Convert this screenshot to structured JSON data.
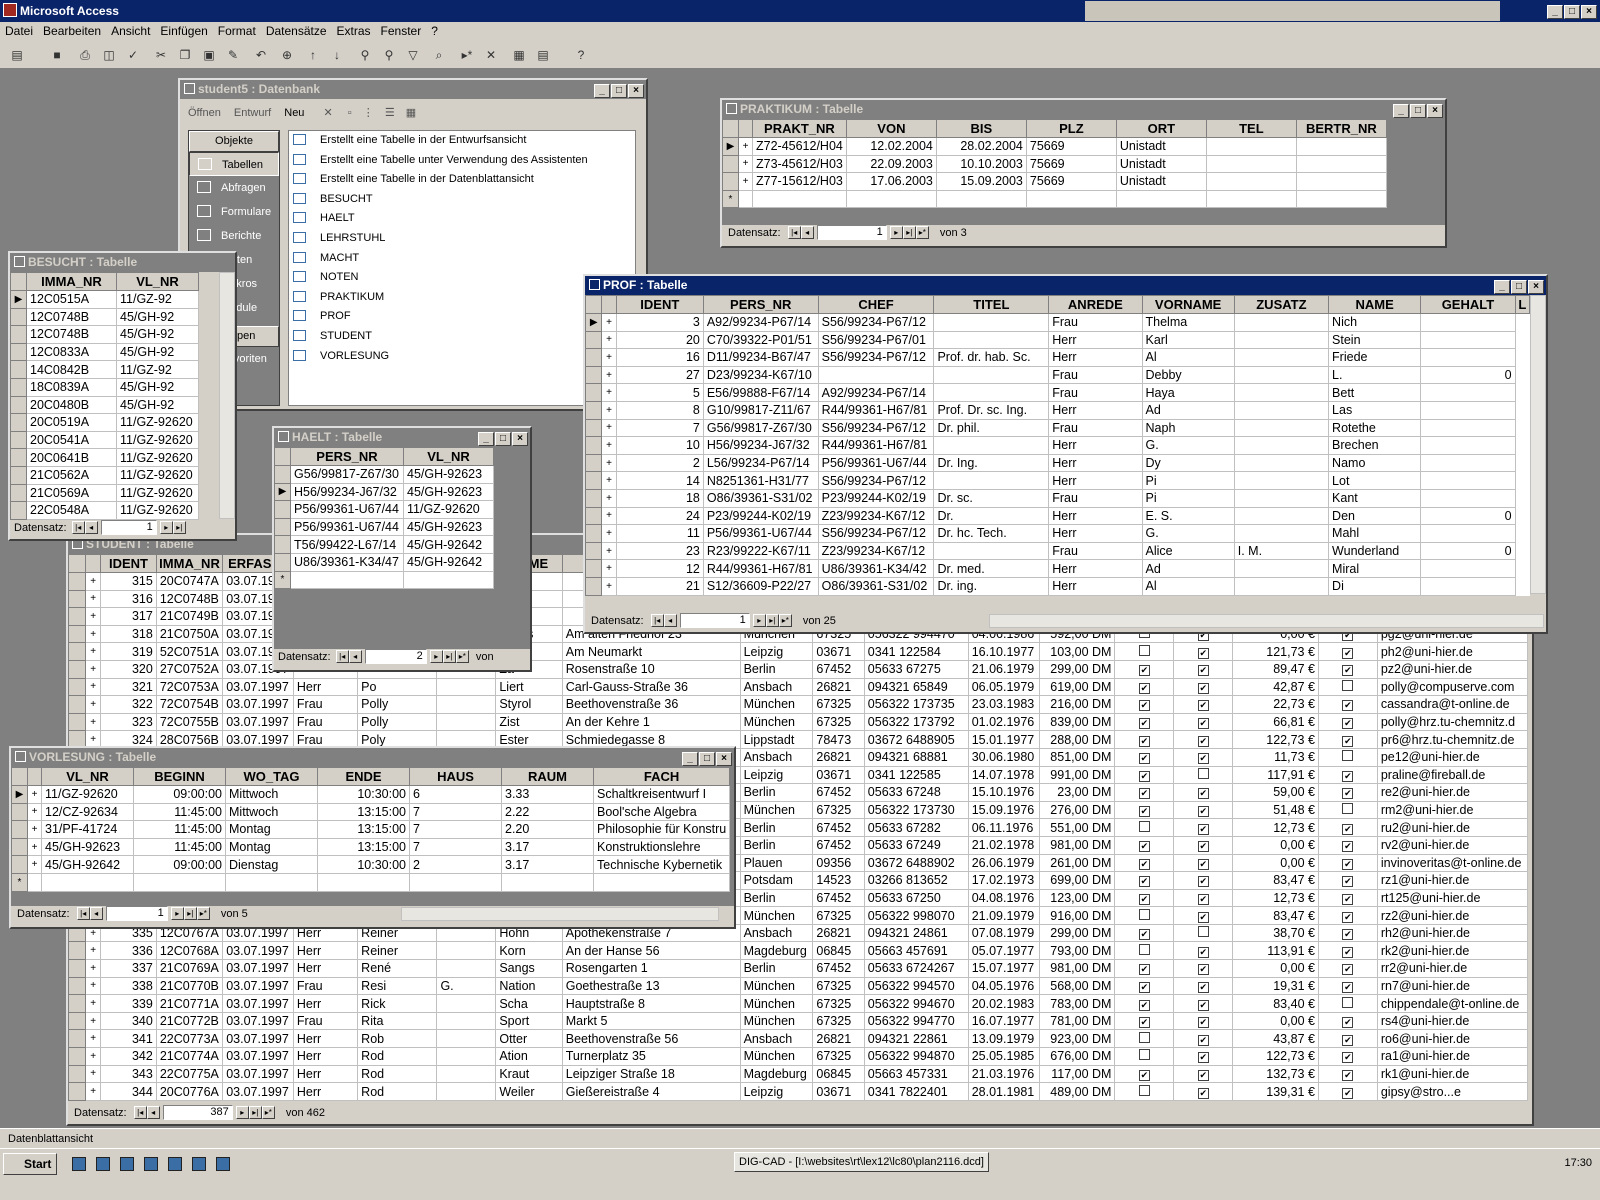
{
  "app": {
    "title": "Microsoft Access"
  },
  "menu": [
    "Datei",
    "Bearbeiten",
    "Ansicht",
    "Einfügen",
    "Format",
    "Datensätze",
    "Extras",
    "Fenster",
    "?"
  ],
  "status": "Datenblattansicht",
  "taskbar": {
    "start": "Start",
    "task": "DIG-CAD - [I:\\websites\\rt\\lex12\\lc80\\plan2116.dcd]",
    "clock": "17:30"
  },
  "db": {
    "title": "student5 : Datenbank",
    "tools": {
      "open": "Öffnen",
      "design": "Entwurf",
      "new": "Neu"
    },
    "objects_label": "Objekte",
    "groups_label": "Gruppen",
    "nav": [
      "Tabellen",
      "Abfragen",
      "Formulare",
      "Berichte",
      "Seiten",
      "Makros",
      "Module"
    ],
    "favorites": "Favoriten",
    "items": [
      "Erstellt eine Tabelle in der Entwurfsansicht",
      "Erstellt eine Tabelle unter Verwendung des Assistenten",
      "Erstellt eine Tabelle in der Datenblattansicht",
      "BESUCHT",
      "HAELT",
      "LEHRSTUHL",
      "MACHT",
      "NOTEN",
      "PRAKTIKUM",
      "PROF",
      "STUDENT",
      "VORLESUNG"
    ]
  },
  "nav_label": "Datensatz:",
  "praktikum": {
    "title": "PRAKTIKUM : Tabelle",
    "cols": [
      "PRAKT_NR",
      "VON",
      "BIS",
      "PLZ",
      "ORT",
      "TEL",
      "BERTR_NR"
    ],
    "rows": [
      [
        "Z72-45612/H04",
        "12.02.2004",
        "28.02.2004",
        "75669",
        "Unistadt",
        "",
        ""
      ],
      [
        "Z73-45612/H03",
        "22.09.2003",
        "10.10.2003",
        "75669",
        "Unistadt",
        "",
        ""
      ],
      [
        "Z77-15612/H03",
        "17.06.2003",
        "15.09.2003",
        "75669",
        "Unistadt",
        "",
        ""
      ]
    ],
    "rec": "1",
    "of": "von 3"
  },
  "besucht": {
    "title": "BESUCHT : Tabelle",
    "cols": [
      "IMMA_NR",
      "VL_NR"
    ],
    "rows": [
      [
        "12C0515A",
        "11/GZ-92"
      ],
      [
        "12C0748B",
        "45/GH-92"
      ],
      [
        "12C0748B",
        "45/GH-92"
      ],
      [
        "12C0833A",
        "45/GH-92"
      ],
      [
        "14C0842B",
        "11/GZ-92"
      ],
      [
        "18C0839A",
        "45/GH-92"
      ],
      [
        "20C0480B",
        "45/GH-92"
      ],
      [
        "20C0519A",
        "11/GZ-92620"
      ],
      [
        "20C0541A",
        "11/GZ-92620"
      ],
      [
        "20C0641B",
        "11/GZ-92620"
      ],
      [
        "21C0562A",
        "11/GZ-92620"
      ],
      [
        "21C0569A",
        "11/GZ-92620"
      ],
      [
        "22C0548A",
        "11/GZ-92620"
      ]
    ],
    "rec": "1"
  },
  "haelt": {
    "title": "HAELT : Tabelle",
    "cols": [
      "PERS_NR",
      "VL_NR"
    ],
    "rows": [
      [
        "G56/99817-Z67/30",
        "45/GH-92623"
      ],
      [
        "H56/99234-J67/32",
        "45/GH-92623"
      ],
      [
        "P56/99361-U67/44",
        "11/GZ-92620"
      ],
      [
        "P56/99361-U67/44",
        "45/GH-92623"
      ],
      [
        "T56/99422-L67/14",
        "45/GH-92642"
      ],
      [
        "U86/39361-K34/47",
        "45/GH-92642"
      ]
    ],
    "rec": "2",
    "of": "von"
  },
  "prof": {
    "title": "PROF : Tabelle",
    "cols": [
      "IDENT",
      "PERS_NR",
      "CHEF",
      "TITEL",
      "ANREDE",
      "VORNAME",
      "ZUSATZ",
      "NAME",
      "GEHALT",
      "L"
    ],
    "rows": [
      [
        "3",
        "A92/99234-P67/14",
        "S56/99234-P67/12",
        "",
        "Frau",
        "Thelma",
        "",
        "Nich",
        ""
      ],
      [
        "20",
        "C70/39322-P01/51",
        "S56/99234-P67/01",
        "",
        "Herr",
        "Karl",
        "",
        "Stein",
        ""
      ],
      [
        "16",
        "D11/99234-B67/47",
        "S56/99234-P67/12",
        "Prof. dr. hab. Sc.",
        "Herr",
        "Al",
        "",
        "Friede",
        ""
      ],
      [
        "27",
        "D23/99234-K67/10",
        "",
        "",
        "Frau",
        "Debby",
        "",
        "L.",
        "0"
      ],
      [
        "5",
        "E56/99888-F67/14",
        "A92/99234-P67/14",
        "",
        "Frau",
        "Haya",
        "",
        "Bett",
        ""
      ],
      [
        "8",
        "G10/99817-Z11/67",
        "R44/99361-H67/81",
        "Prof. Dr. sc. Ing.",
        "Herr",
        "Ad",
        "",
        "Las",
        ""
      ],
      [
        "7",
        "G56/99817-Z67/30",
        "S56/99234-P67/12",
        "Dr. phil.",
        "Frau",
        "Naph",
        "",
        "Rotethe",
        ""
      ],
      [
        "10",
        "H56/99234-J67/32",
        "R44/99361-H67/81",
        "",
        "Herr",
        "G.",
        "",
        "Brechen",
        ""
      ],
      [
        "2",
        "L56/99234-P67/14",
        "P56/99361-U67/44",
        "Dr. Ing.",
        "Herr",
        "Dy",
        "",
        "Namo",
        ""
      ],
      [
        "14",
        "N8251361-H31/77",
        "S56/99234-P67/12",
        "",
        "Herr",
        "Pi",
        "",
        "Lot",
        ""
      ],
      [
        "18",
        "O86/39361-S31/02",
        "P23/99244-K02/19",
        "Dr. sc.",
        "Frau",
        "Pi",
        "",
        "Kant",
        ""
      ],
      [
        "24",
        "P23/99244-K02/19",
        "Z23/99234-K67/12",
        "Dr.",
        "Herr",
        "E. S.",
        "",
        "Den",
        "0"
      ],
      [
        "11",
        "P56/99361-U67/44",
        "S56/99234-P67/12",
        "Dr. hc. Tech.",
        "Herr",
        "G.",
        "",
        "Mahl",
        ""
      ],
      [
        "23",
        "R23/99222-K67/11",
        "Z23/99234-K67/12",
        "",
        "Frau",
        "Alice",
        "I. M.",
        "Wunderland",
        "0"
      ],
      [
        "12",
        "R44/99361-H67/81",
        "U86/39361-K34/42",
        "Dr. med.",
        "Herr",
        "Ad",
        "",
        "Miral",
        ""
      ],
      [
        "21",
        "S12/36609-P22/27",
        "O86/39361-S31/02",
        "Dr. ing.",
        "Herr",
        "Al",
        "",
        "Di",
        ""
      ]
    ],
    "rec": "1",
    "of": "von 25"
  },
  "vorlesung": {
    "title": "VORLESUNG : Tabelle",
    "cols": [
      "VL_NR",
      "BEGINN",
      "WO_TAG",
      "ENDE",
      "HAUS",
      "RAUM",
      "FACH"
    ],
    "rows": [
      [
        "11/GZ-92620",
        "09:00:00",
        "Mittwoch",
        "10:30:00",
        "6",
        "3.33",
        "Schaltkreisentwurf I"
      ],
      [
        "12/CZ-92634",
        "11:45:00",
        "Mittwoch",
        "13:15:00",
        "7",
        "2.22",
        "Bool'sche Algebra"
      ],
      [
        "31/PF-41724",
        "11:45:00",
        "Montag",
        "13:15:00",
        "7",
        "2.20",
        "Philosophie für Konstru"
      ],
      [
        "45/GH-92623",
        "11:45:00",
        "Montag",
        "13:15:00",
        "7",
        "3.17",
        "Konstruktionslehre"
      ],
      [
        "45/GH-92642",
        "09:00:00",
        "Dienstag",
        "10:30:00",
        "2",
        "3.17",
        "Technische Kybernetik"
      ]
    ],
    "rec": "1",
    "of": "von 5"
  },
  "student": {
    "title": "STUDENT : Tabelle",
    "cols": [
      "IDENT",
      "IMMA_NR",
      "ERFASST",
      "ANREDE",
      "VORNAME",
      "ZUSATZ",
      "NAME",
      "STRASSE",
      "ORT",
      "PLZ",
      "TEL",
      "GEBDAT",
      "BAFOEG",
      "K1",
      "K2",
      "BETRAG",
      "K3",
      "EMAIL"
    ],
    "rows": [
      [
        "315",
        "20C0747A",
        "03.07.1997",
        "",
        "",
        "",
        "Laus",
        "",
        "",
        "",
        "",
        "",
        "",
        "",
        "",
        "",
        "",
        ""
      ],
      [
        "316",
        "12C0748B",
        "03.07.1997",
        "",
        "",
        "",
        "Nist",
        "",
        "",
        "",
        "",
        "",
        "",
        "",
        "",
        "",
        "",
        ""
      ],
      [
        "317",
        "21C0749B",
        "03.07.1997",
        "",
        "",
        "",
        "No",
        "",
        "",
        "",
        "",
        "",
        "",
        "",
        "",
        "",
        "",
        ""
      ],
      [
        "318",
        "21C0750A",
        "03.07.1997",
        "",
        "",
        "",
        "Goras",
        "Am alten Friedhof 23",
        "München",
        "67325",
        "056322 994470",
        "04.06.1986",
        "592,00 DM",
        "0",
        "1",
        "0,00 €",
        "1",
        "pg2@uni-hier.de"
      ],
      [
        "319",
        "52C0751A",
        "03.07.1997",
        "",
        "",
        "",
        "Naß",
        "Am Neumarkt",
        "Leipzig",
        "03671",
        "0341 122584",
        "16.10.1977",
        "103,00 DM",
        "0",
        "1",
        "121,73 €",
        "1",
        "ph2@uni-hier.de"
      ],
      [
        "320",
        "27C0752A",
        "03.07.1997",
        "",
        "",
        "",
        "Za",
        "Rosenstraße 10",
        "Berlin",
        "67452",
        "05633 67275",
        "21.06.1979",
        "299,00 DM",
        "1",
        "1",
        "89,47 €",
        "1",
        "pz2@uni-hier.de"
      ],
      [
        "321",
        "72C0753A",
        "03.07.1997",
        "Herr",
        "Po",
        "",
        "Liert",
        "Carl-Gauss-Straße 36",
        "Ansbach",
        "26821",
        "094321 65849",
        "06.05.1979",
        "619,00 DM",
        "1",
        "1",
        "42,87 €",
        "0",
        "polly@compuserve.com"
      ],
      [
        "322",
        "72C0754B",
        "03.07.1997",
        "Frau",
        "Polly",
        "",
        "Styrol",
        "Beethovenstraße 36",
        "München",
        "67325",
        "056322 173735",
        "23.03.1983",
        "216,00 DM",
        "1",
        "1",
        "22,73 €",
        "1",
        "cassandra@t-online.de"
      ],
      [
        "323",
        "72C0755B",
        "03.07.1997",
        "Frau",
        "Polly",
        "",
        "Zist",
        "An der Kehre 1",
        "München",
        "67325",
        "056322 173792",
        "01.02.1976",
        "839,00 DM",
        "1",
        "1",
        "66,81 €",
        "1",
        "polly@hrz.tu-chemnitz.d"
      ],
      [
        "324",
        "28C0756B",
        "03.07.1997",
        "Frau",
        "Poly",
        "",
        "Ester",
        "Schmiedegasse 8",
        "Lippstadt",
        "78473",
        "03672 6488905",
        "15.01.1977",
        "288,00 DM",
        "1",
        "1",
        "122,73 €",
        "1",
        "pr6@hrz.tu-chemnitz.de"
      ],
      [
        "325",
        "",
        "",
        "",
        "",
        "",
        "",
        "aße 36",
        "Ansbach",
        "26821",
        "094321 68881",
        "30.06.1980",
        "851,00 DM",
        "1",
        "1",
        "11,73 €",
        "0",
        "pe12@uni-hier.de"
      ],
      [
        "326",
        "",
        "",
        "",
        "",
        "",
        "",
        "",
        "Leipzig",
        "03671",
        "0341 122585",
        "14.07.1978",
        "991,00 DM",
        "1",
        "0",
        "117,91 €",
        "1",
        "praline@fireball.de"
      ],
      [
        "327",
        "",
        "",
        "",
        "",
        "",
        "",
        "",
        "Berlin",
        "67452",
        "05633 67248",
        "15.10.1976",
        "23,00 DM",
        "1",
        "1",
        "59,00 €",
        "1",
        "re2@uni-hier.de"
      ],
      [
        "328",
        "",
        "",
        "",
        "",
        "",
        "",
        "",
        "München",
        "67325",
        "056322 173730",
        "15.09.1976",
        "276,00 DM",
        "1",
        "1",
        "51,48 €",
        "0",
        "rm2@uni-hier.de"
      ],
      [
        "329",
        "",
        "",
        "",
        "",
        "",
        "",
        "",
        "Berlin",
        "67452",
        "05633 67282",
        "06.11.1976",
        "551,00 DM",
        "0",
        "1",
        "12,73 €",
        "1",
        "ru2@uni-hier.de"
      ],
      [
        "330",
        "",
        "",
        "",
        "",
        "",
        "",
        "",
        "Berlin",
        "67452",
        "05633 67249",
        "21.02.1978",
        "981,00 DM",
        "1",
        "1",
        "0,00 €",
        "1",
        "rv2@uni-hier.de"
      ],
      [
        "331",
        "",
        "",
        "",
        "",
        "",
        "",
        "",
        "Plauen",
        "09356",
        "03672 6488902",
        "26.06.1979",
        "261,00 DM",
        "1",
        "1",
        "0,00 €",
        "1",
        "invinoveritas@t-online.de"
      ],
      [
        "332",
        "",
        "",
        "",
        "",
        "",
        "",
        "",
        "Potsdam",
        "14523",
        "03266 813652",
        "17.02.1973",
        "699,00 DM",
        "1",
        "1",
        "83,47 €",
        "1",
        "rz1@uni-hier.de"
      ],
      [
        "333",
        "",
        "",
        "",
        "",
        "",
        "",
        "",
        "Berlin",
        "67452",
        "05633 67250",
        "04.08.1976",
        "123,00 DM",
        "1",
        "1",
        "12,73 €",
        "1",
        "rt125@uni-hier.de"
      ],
      [
        "334",
        "",
        "",
        "",
        "",
        "",
        "",
        "",
        "München",
        "67325",
        "056322 998070",
        "21.09.1979",
        "916,00 DM",
        "0",
        "1",
        "83,47 €",
        "1",
        "rz2@uni-hier.de"
      ],
      [
        "335",
        "12C0767A",
        "03.07.1997",
        "Herr",
        "Reiner",
        "",
        "Hohn",
        "Apothekenstraße 7",
        "Ansbach",
        "26821",
        "094321 24861",
        "07.08.1979",
        "299,00 DM",
        "1",
        "0",
        "38,70 €",
        "1",
        "rh2@uni-hier.de"
      ],
      [
        "336",
        "12C0768A",
        "03.07.1997",
        "Herr",
        "Reiner",
        "",
        "Korn",
        "An der Hanse 56",
        "Magdeburg",
        "06845",
        "05663 457691",
        "05.07.1977",
        "793,00 DM",
        "0",
        "1",
        "113,91 €",
        "1",
        "rk2@uni-hier.de"
      ],
      [
        "337",
        "21C0769A",
        "03.07.1997",
        "Herr",
        "René",
        "",
        "Sangs",
        "Rosengarten 1",
        "Berlin",
        "67452",
        "05633 6724267",
        "15.07.1977",
        "981,00 DM",
        "1",
        "1",
        "0,00 €",
        "1",
        "rr2@uni-hier.de"
      ],
      [
        "338",
        "21C0770B",
        "03.07.1997",
        "Frau",
        "Resi",
        "G.",
        "Nation",
        "Goethestraße 13",
        "München",
        "67325",
        "056322 994570",
        "04.05.1976",
        "568,00 DM",
        "1",
        "1",
        "19,31 €",
        "1",
        "rn7@uni-hier.de"
      ],
      [
        "339",
        "21C0771A",
        "03.07.1997",
        "Herr",
        "Rick",
        "",
        "Scha",
        "Hauptstraße 8",
        "München",
        "67325",
        "056322 994670",
        "20.02.1983",
        "783,00 DM",
        "1",
        "1",
        "83,40 €",
        "0",
        "chippendale@t-online.de"
      ],
      [
        "340",
        "21C0772B",
        "03.07.1997",
        "Frau",
        "Rita",
        "",
        "Sport",
        "Markt 5",
        "München",
        "67325",
        "056322 994770",
        "16.07.1977",
        "781,00 DM",
        "1",
        "1",
        "0,00 €",
        "1",
        "rs4@uni-hier.de"
      ],
      [
        "341",
        "22C0773A",
        "03.07.1997",
        "Herr",
        "Rob",
        "",
        "Otter",
        "Beethovenstraße 56",
        "Ansbach",
        "26821",
        "094321 22861",
        "13.09.1979",
        "923,00 DM",
        "0",
        "1",
        "43,87 €",
        "1",
        "ro6@uni-hier.de"
      ],
      [
        "342",
        "21C0774A",
        "03.07.1997",
        "Herr",
        "Rod",
        "",
        "Ation",
        "Turnerplatz 35",
        "München",
        "67325",
        "056322 994870",
        "25.05.1985",
        "676,00 DM",
        "0",
        "1",
        "122,73 €",
        "1",
        "ra1@uni-hier.de"
      ],
      [
        "343",
        "22C0775A",
        "03.07.1997",
        "Herr",
        "Rod",
        "",
        "Kraut",
        "Leipziger Straße 18",
        "Magdeburg",
        "06845",
        "05663 457331",
        "21.03.1976",
        "117,00 DM",
        "1",
        "1",
        "132,73 €",
        "1",
        "rk1@uni-hier.de"
      ],
      [
        "344",
        "20C0776A",
        "03.07.1997",
        "Herr",
        "Rod",
        "",
        "Weiler",
        "Gießereistraße 4",
        "Leipzig",
        "03671",
        "0341 7822401",
        "28.01.1981",
        "489,00 DM",
        "0",
        "1",
        "139,31 €",
        "1",
        "gipsy@stro...e"
      ]
    ],
    "rec": "387",
    "of": "von 462"
  }
}
